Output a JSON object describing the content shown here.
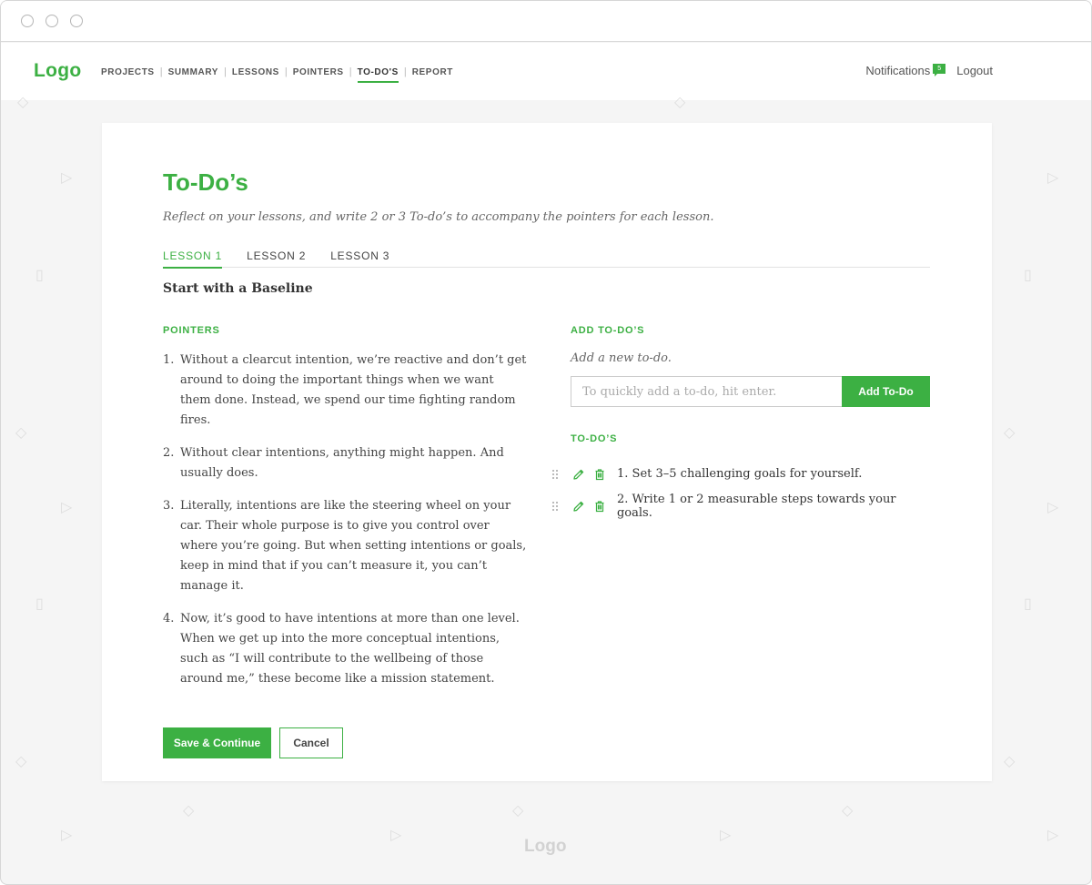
{
  "nav": {
    "logo": "Logo",
    "links": [
      "PROJECTS",
      "SUMMARY",
      "LESSONS",
      "POINTERS",
      "TO-DO'S",
      "REPORT"
    ],
    "active_link": "TO-DO'S",
    "notifications_label": "Notifications",
    "notifications_count": "5",
    "logout_label": "Logout"
  },
  "page": {
    "title": "To-Do’s",
    "subtitle": "Reflect on your lessons, and write 2 or 3 To-do’s to accompany the pointers for each lesson.",
    "tabs": [
      "LESSON 1",
      "LESSON 2",
      "LESSON 3"
    ],
    "active_tab": "LESSON 1",
    "lesson_heading": "Start with a Baseline"
  },
  "pointers": {
    "label": "POINTERS",
    "items": [
      {
        "num": "1.",
        "text": "Without a clearcut intention, we’re reactive and don’t get around to doing the important things when we want them done. Instead, we spend our time fighting random fires."
      },
      {
        "num": "2.",
        "text": "Without clear intentions, anything might happen. And usually does."
      },
      {
        "num": "3.",
        "text": "Literally, intentions are like the steering wheel on your car. Their whole purpose is to give you control over where you’re going. But when setting intentions or goals, keep in mind that if you can’t measure it, you can’t manage it."
      },
      {
        "num": "4.",
        "text": "Now, it’s good to have intentions at more than one level. When we get up into the more conceptual intentions, such as “I will contribute to the wellbeing of those around me,” these become like a mission statement."
      }
    ]
  },
  "add_todos": {
    "label": "ADD TO-DO’S",
    "hint": "Add a new to-do.",
    "input_value": "",
    "input_placeholder": "To quickly add a to-do, hit enter.",
    "button_label": "Add To-Do"
  },
  "todos": {
    "label": "TO-DO’S",
    "items": [
      {
        "text": "1.  Set 3–5 challenging goals for yourself."
      },
      {
        "text": "2. Write 1 or 2 measurable steps towards your goals."
      }
    ]
  },
  "actions": {
    "save_label": "Save & Continue",
    "cancel_label": "Cancel"
  },
  "footer": {
    "logo": "Logo"
  },
  "colors": {
    "accent": "#3cb043",
    "background": "#f5f5f5"
  },
  "icons": [
    "drag-handle-icon",
    "pencil-icon",
    "trash-icon",
    "notification-icon"
  ]
}
